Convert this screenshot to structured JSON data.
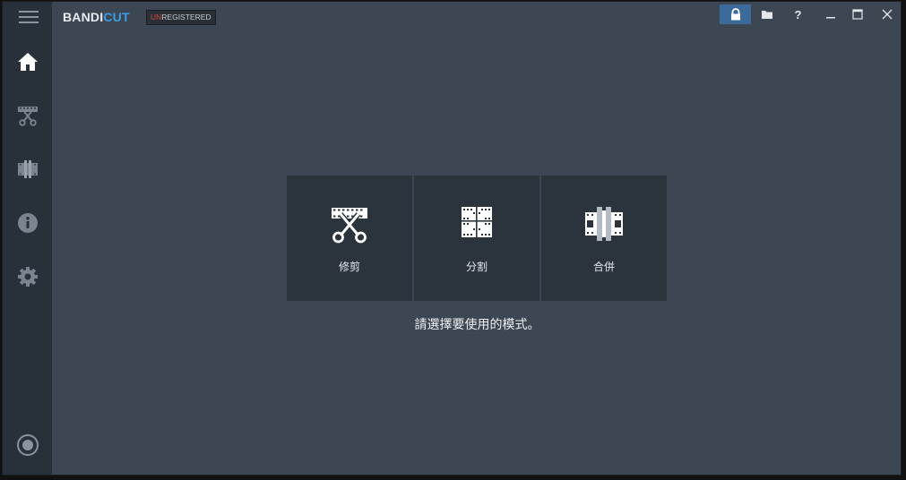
{
  "app": {
    "logo_main": "BANDI",
    "logo_accent": "CUT",
    "badge_prefix": "UN",
    "badge_rest": "REGISTERED"
  },
  "colors": {
    "accent": "#3a9ee4",
    "badge_red": "#e0463e",
    "active_control": "#3b6a9b",
    "background": "#3d4753",
    "sidebar": "#28303a",
    "tile": "#2b333d"
  },
  "sidebar": {
    "items": [
      {
        "icon": "home-icon"
      },
      {
        "icon": "trim-icon"
      },
      {
        "icon": "join-icon"
      },
      {
        "icon": "info-icon"
      },
      {
        "icon": "gear-icon"
      }
    ],
    "bottom_icon": "record-icon"
  },
  "titlebar": {
    "controls": [
      {
        "icon": "lock-icon"
      },
      {
        "icon": "folder-icon"
      },
      {
        "icon": "help-icon",
        "label": "?"
      },
      {
        "icon": "minimize-icon"
      },
      {
        "icon": "maximize-icon"
      },
      {
        "icon": "close-icon"
      }
    ]
  },
  "modes": [
    {
      "icon": "trim-icon",
      "label": "修剪"
    },
    {
      "icon": "split-icon",
      "label": "分割"
    },
    {
      "icon": "join-icon",
      "label": "合併"
    }
  ],
  "hint": "請選擇要使用的模式。"
}
